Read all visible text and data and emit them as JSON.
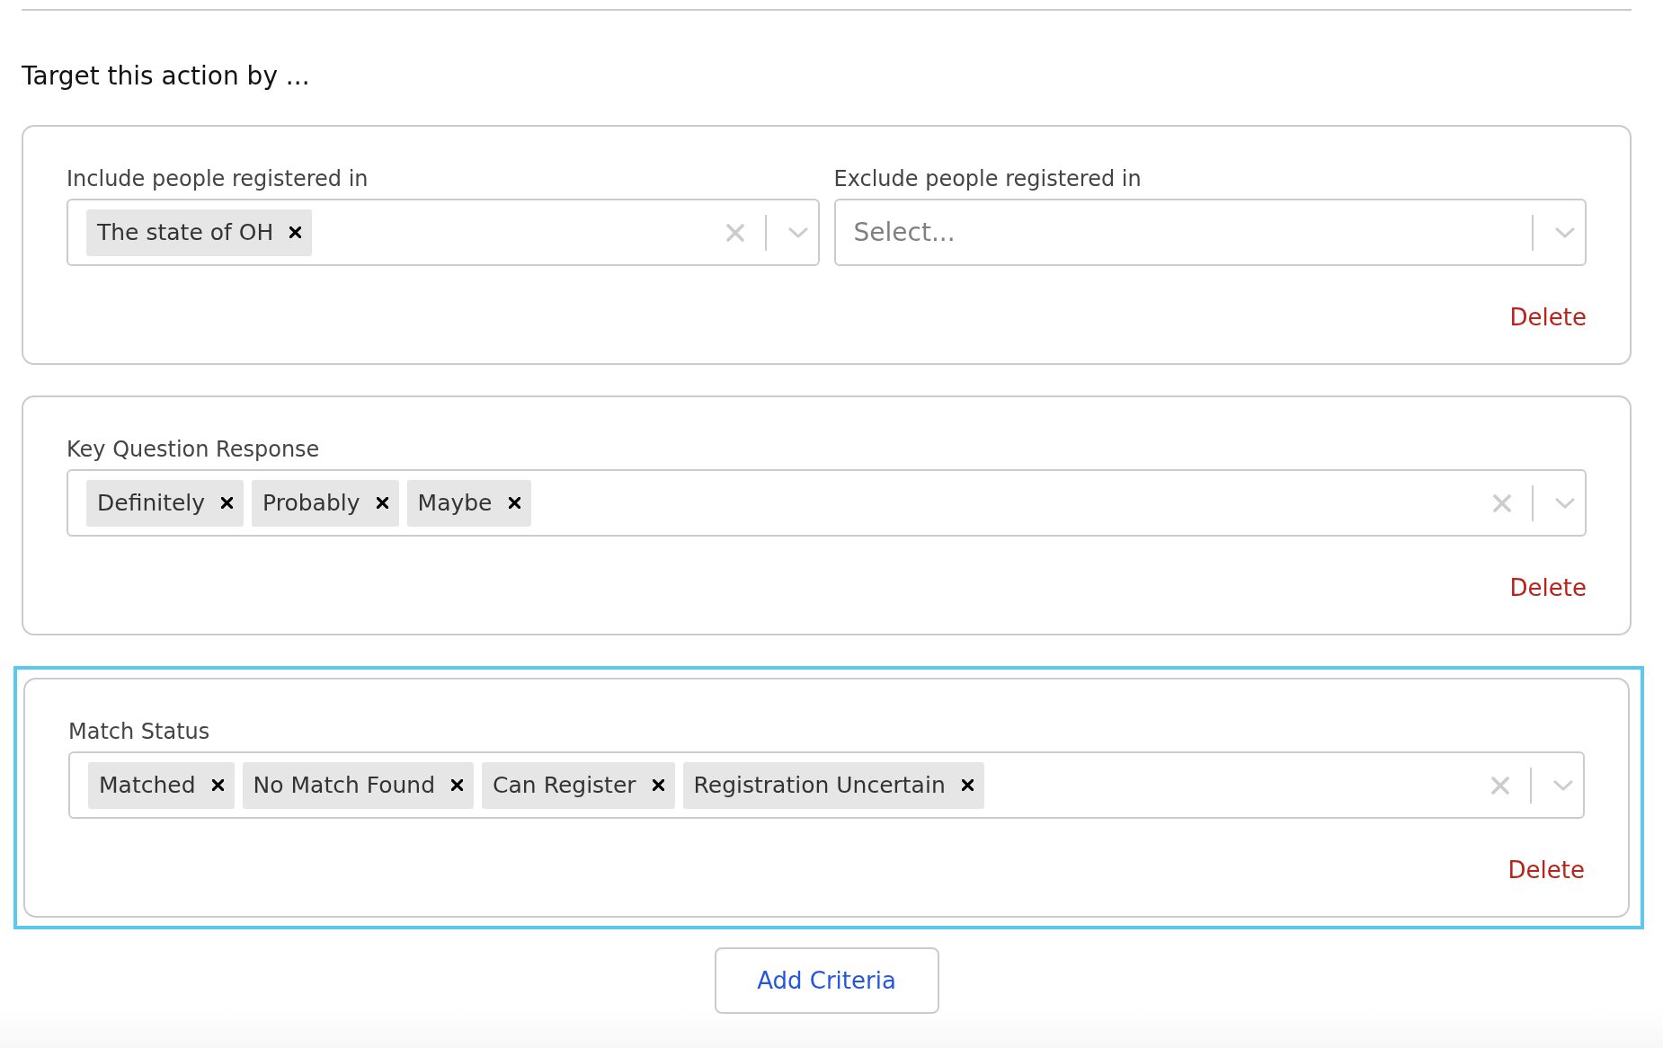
{
  "heading": "Target this action by ...",
  "criteria": [
    {
      "highlighted": false,
      "fields": [
        {
          "label": "Include people registered in",
          "tags": [
            "The state of OH"
          ]
        },
        {
          "label": "Exclude people registered in",
          "placeholder": "Select..."
        }
      ],
      "delete": "Delete"
    },
    {
      "highlighted": false,
      "fields": [
        {
          "label": "Key Question Response",
          "tags": [
            "Definitely",
            "Probably",
            "Maybe"
          ]
        }
      ],
      "delete": "Delete"
    },
    {
      "highlighted": true,
      "fields": [
        {
          "label": "Match Status",
          "tags": [
            "Matched",
            "No Match Found",
            "Can Register",
            "Registration Uncertain"
          ]
        }
      ],
      "delete": "Delete"
    }
  ],
  "add_button": "Add Criteria"
}
